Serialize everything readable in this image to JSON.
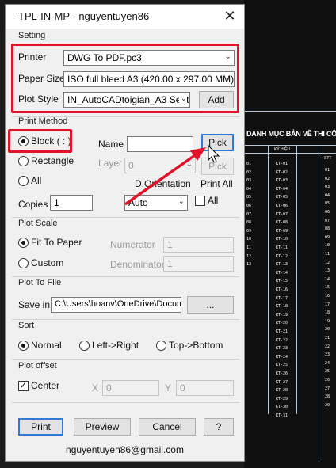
{
  "window": {
    "title": "TPL-IN-MP - nguyentuyen86",
    "close_glyph": "✕"
  },
  "setting": {
    "group_label": "Setting",
    "printer_label": "Printer",
    "printer_value": "DWG To PDF.pc3",
    "paper_size_label": "Paper Size",
    "paper_size_value": "ISO full bleed A3 (420.00 x 297.00 MM)",
    "plot_style_label": "Plot Style",
    "plot_style_value": "IN_AutoCADtoigian_A3 Sent",
    "add_button": "Add"
  },
  "print_method": {
    "group_label": "Print Method",
    "block_option": "Block ( : )",
    "rectangle_option": "Rectangle",
    "all_option": "All",
    "name_label": "Name",
    "name_value": "",
    "pick_button": "Pick",
    "layer_label": "Layer",
    "layer_value": "0",
    "pick_layer_button": "Pick",
    "orientation_label": "D.Orientation",
    "orientation_value": "Auto",
    "print_all_label": "Print All",
    "print_all_checkbox": "All",
    "copies_label": "Copies",
    "copies_value": "1"
  },
  "plot_scale": {
    "group_label": "Plot Scale",
    "fit_option": "Fit To Paper",
    "custom_option": "Custom",
    "numerator_label": "Numerator",
    "numerator_value": "1",
    "denominator_label": "Denominator",
    "denominator_value": "1"
  },
  "plot_to_file": {
    "group_label": "Plot To File",
    "save_in_label": "Save in",
    "path_value": "C:\\Users\\hoanv\\OneDrive\\Docum",
    "browse_button": "..."
  },
  "sort": {
    "group_label": "Sort",
    "normal_option": "Normal",
    "left_right_option": "Left->Right",
    "top_bottom_option": "Top->Bottom"
  },
  "plot_offset": {
    "group_label": "Plot offset",
    "center_label": "Center",
    "x_label": "X",
    "x_value": "0",
    "y_label": "Y",
    "y_value": "0"
  },
  "buttons": {
    "print": "Print",
    "preview": "Preview",
    "cancel": "Cancel",
    "help": "?"
  },
  "footer": {
    "email": "nguyentuyen86@gmail.com"
  },
  "cad": {
    "title": "DANH MỤC BẢN VẼ THI CÔ",
    "header": "KÝ HIỆU",
    "header2": "STT",
    "codes": [
      "KT-01",
      "KT-02",
      "KT-03",
      "KT-04",
      "KT-05",
      "KT-06",
      "KT-07",
      "KT-08",
      "KT-09",
      "KT-10",
      "KT-11",
      "KT-12",
      "KT-13",
      "KT-14",
      "KT-15",
      "KT-16",
      "KT-17",
      "KT-18",
      "KT-19",
      "KT-20",
      "KT-21",
      "KT-22",
      "KT-23",
      "KT-24",
      "KT-25",
      "KT-26",
      "KT-27",
      "KT-28",
      "KT-29",
      "KT-30",
      "KT-31"
    ],
    "left_codes": [
      "01",
      "02",
      "03",
      "04",
      "05",
      "06",
      "07",
      "08",
      "09",
      "10",
      "11",
      "12",
      "13"
    ],
    "right_nums": [
      "01",
      "02",
      "03",
      "04",
      "05",
      "06",
      "07",
      "08",
      "09",
      "10",
      "11",
      "12",
      "13",
      "14",
      "15",
      "16",
      "17",
      "18",
      "19",
      "20",
      "21",
      "22",
      "23",
      "24",
      "25",
      "26",
      "27",
      "28",
      "29"
    ]
  },
  "colors": {
    "highlight": "#e2122b",
    "focus": "#2f7ad6"
  }
}
